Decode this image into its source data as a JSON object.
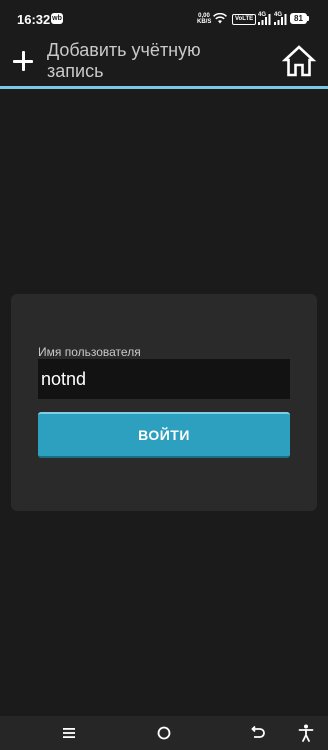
{
  "status_bar": {
    "time": "16:32",
    "app_badge": "wb",
    "net_speed_value": "0,00",
    "net_speed_unit": "KB/S",
    "volte_label": "VoLTE",
    "signal_1_label": "4G",
    "signal_2_label": "4G",
    "battery_level": "81"
  },
  "header": {
    "title": "Добавить учётную запись",
    "add_icon": "plus-icon",
    "home_icon": "home-icon",
    "accent_color": "#7cc7e6"
  },
  "login_form": {
    "username_label": "Имя пользователя",
    "username_value": "notnd",
    "login_button_label": "ВОЙТИ",
    "button_color": "#2ea0bf"
  },
  "nav_bar": {
    "menu_icon": "menu-icon",
    "home_icon": "circle-home-icon",
    "back_icon": "back-icon",
    "accessibility_icon": "accessibility-icon"
  }
}
